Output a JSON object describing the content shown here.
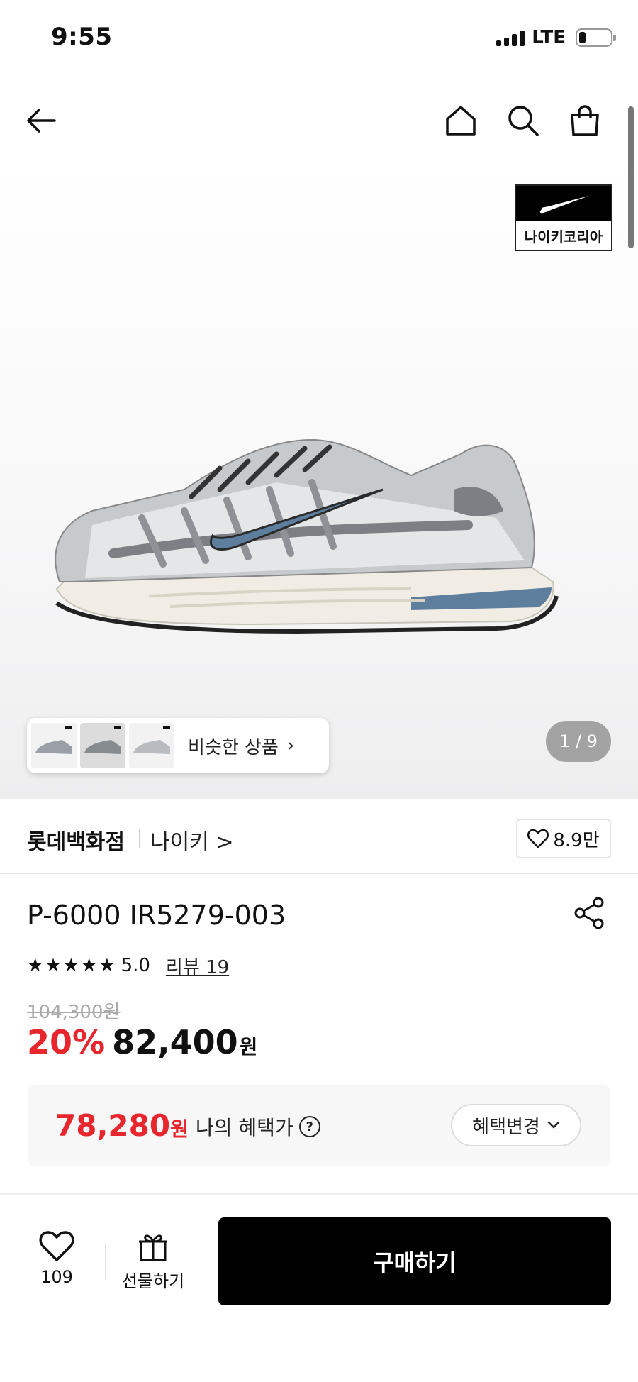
{
  "status_bar": {
    "time": "9:55",
    "network": "LTE",
    "battery_level": 0.22
  },
  "nav": {
    "icons": [
      "back-arrow-icon",
      "home-icon",
      "search-icon",
      "shopping-bag-icon"
    ]
  },
  "hero": {
    "brand_badge_text": "나이키코리아",
    "similar_products_label": "비슷한 상품",
    "page_indicator": "1 / 9"
  },
  "store": {
    "name": "롯데백화점",
    "brand_link": "나이키 >",
    "likes": "8.9만"
  },
  "product": {
    "title": "P-6000 IR5279-003",
    "rating": "5.0",
    "stars": 5,
    "review_link": "리뷰 19",
    "original_price": "104,300원",
    "discount": "20%",
    "price": "82,400",
    "currency": "원"
  },
  "benefit": {
    "price": "78,280",
    "currency": "원",
    "label": "나의 혜택가",
    "change_button": "혜택변경"
  },
  "bottom_bar": {
    "wish_count": "109",
    "gift_label": "선물하기",
    "buy_label": "구매하기"
  },
  "colors": {
    "accent_red": "#e8262d",
    "buy_button": "#000000",
    "shoe_swoosh": "#5e7e9e"
  }
}
